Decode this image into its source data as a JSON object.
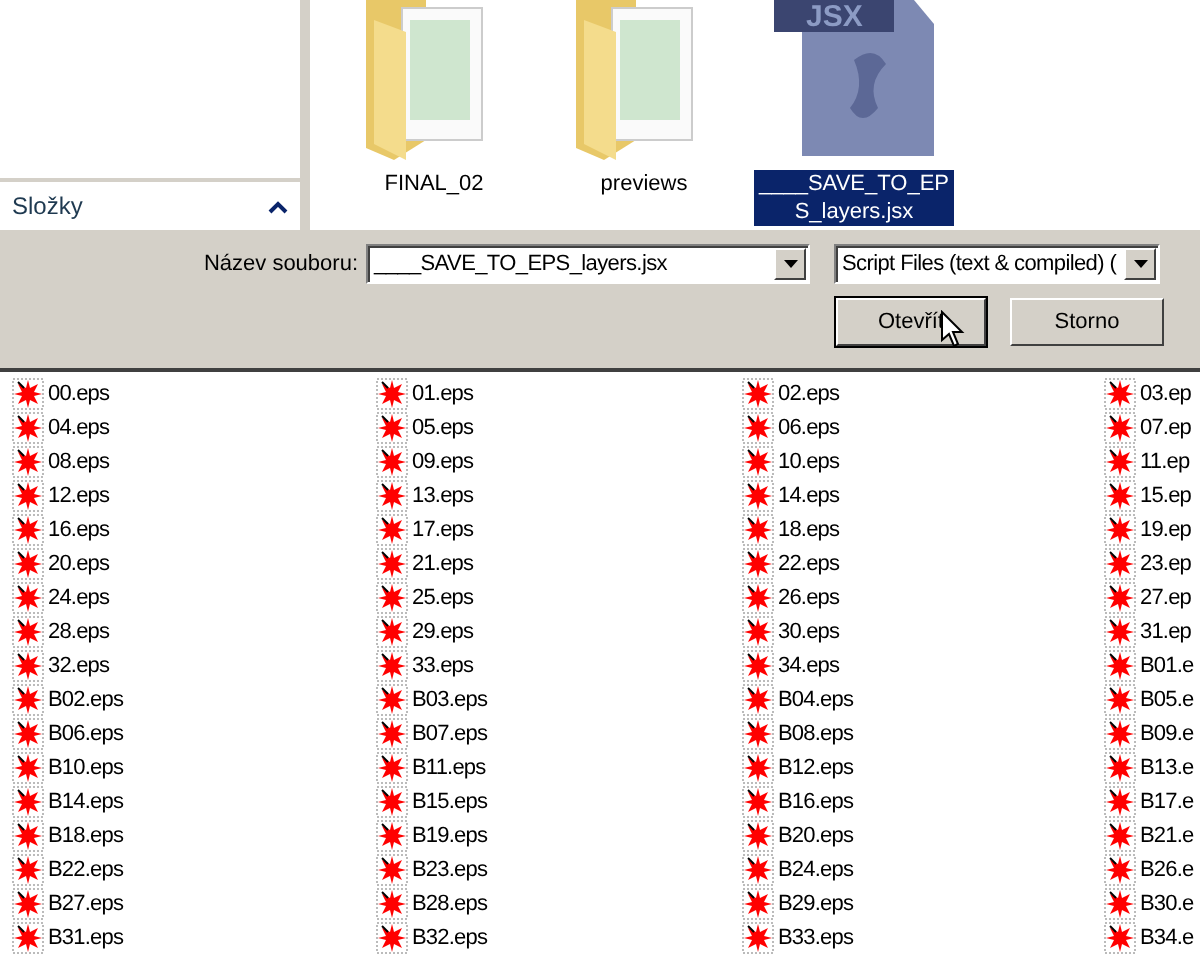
{
  "dialog": {
    "sidebar": {
      "section_label": "Složky",
      "expanded": true
    },
    "files": [
      {
        "name": "FINAL_02",
        "kind": "folder",
        "selected": false
      },
      {
        "name": "previews",
        "kind": "folder",
        "selected": false
      },
      {
        "name": "____SAVE_TO_EPS_layers.jsx",
        "kind": "script",
        "badge": "JSX",
        "selected": true
      }
    ],
    "filename_label": "Název souboru:",
    "filename_value": "____SAVE_TO_EPS_layers.jsx",
    "file_type": "Script Files (text & compiled) (",
    "buttons": [
      {
        "label": "Otevřít",
        "default": true
      },
      {
        "label": "Storno",
        "default": false
      }
    ]
  },
  "background_list": {
    "files": [
      "00.eps",
      "01.eps",
      "02.eps",
      "03.ep",
      "04.eps",
      "05.eps",
      "06.eps",
      "07.ep",
      "08.eps",
      "09.eps",
      "10.eps",
      "11.ep",
      "12.eps",
      "13.eps",
      "14.eps",
      "15.ep",
      "16.eps",
      "17.eps",
      "18.eps",
      "19.ep",
      "20.eps",
      "21.eps",
      "22.eps",
      "23.ep",
      "24.eps",
      "25.eps",
      "26.eps",
      "27.ep",
      "28.eps",
      "29.eps",
      "30.eps",
      "31.ep",
      "32.eps",
      "33.eps",
      "34.eps",
      "B01.e",
      "B02.eps",
      "B03.eps",
      "B04.eps",
      "B05.e",
      "B06.eps",
      "B07.eps",
      "B08.eps",
      "B09.e",
      "B10.eps",
      "B11.eps",
      "B12.eps",
      "B13.e",
      "B14.eps",
      "B15.eps",
      "B16.eps",
      "B17.e",
      "B18.eps",
      "B19.eps",
      "B20.eps",
      "B21.e",
      "B22.eps",
      "B23.eps",
      "B24.eps",
      "B26.e",
      "B27.eps",
      "B28.eps",
      "B29.eps",
      "B30.e",
      "B31.eps",
      "B32.eps",
      "B33.eps",
      "B34.e"
    ]
  }
}
